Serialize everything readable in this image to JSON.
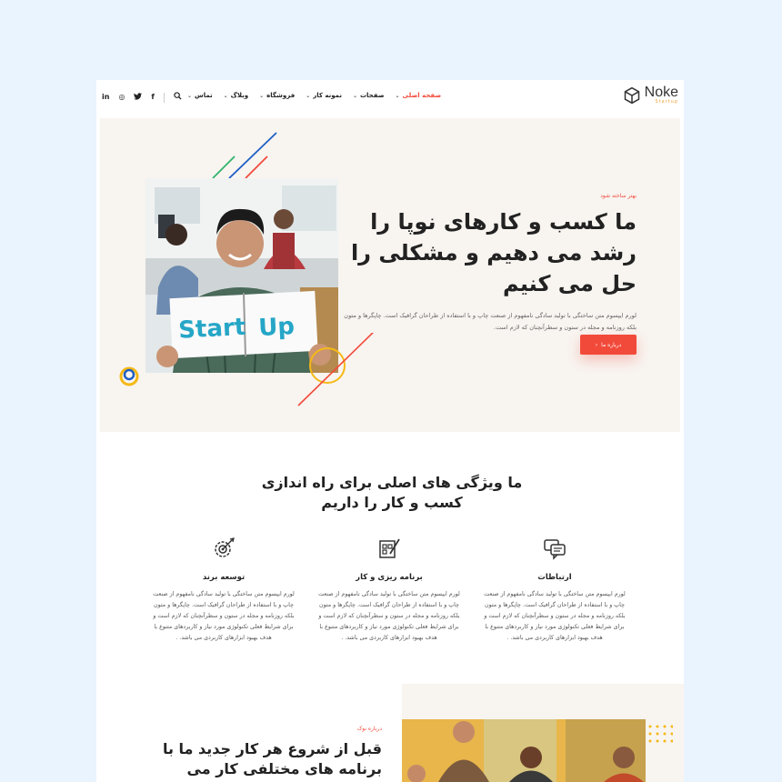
{
  "brand": {
    "name": "Noke",
    "tagline": "Startup"
  },
  "nav": {
    "items": [
      {
        "label": "صفحه اصلی",
        "active": true
      },
      {
        "label": "صفحات",
        "active": false
      },
      {
        "label": "نمونه کار",
        "active": false
      },
      {
        "label": "فروشگاه",
        "active": false
      },
      {
        "label": "وبلاگ",
        "active": false
      },
      {
        "label": "تماس",
        "active": false
      }
    ]
  },
  "social": {
    "icons": [
      "linkedin-icon",
      "instagram-icon",
      "twitter-icon",
      "facebook-icon",
      "search-icon"
    ],
    "glyphs": [
      "in",
      "◎",
      "🐦",
      "f",
      "⌕"
    ]
  },
  "hero": {
    "kicker": "بهتر ساخته شود",
    "title": "ما کسب و کارهای نوپا را رشد می دهیم و مشکلی را حل می کنیم",
    "description": "لورم ایپسوم متن ساختگی با تولید سادگی نامفهوم از صنعت چاپ و با استفاده از طراحان گرافیک است. چاپگرها و متون بلکه روزنامه و مجله در ستون و سطرآنچنان که لازم است.",
    "button_label": "درباره ما",
    "image_text": "Start Up"
  },
  "features": {
    "title": "ما ویژگی های اصلی برای راه اندازی کسب و کار را داریم",
    "items": [
      {
        "title": "ارتباطات",
        "icon": "chat-icon",
        "text": "لورم ایپسوم متن ساختگی با تولید سادگی نامفهوم از صنعت چاپ و با استفاده از طراحان گرافیک است. چاپگرها و متون بلکه روزنامه و مجله در ستون و سطرآنچنان که لازم است و برای شرایط فعلی تکنولوژی مورد نیاز و کاربردهای متنوع با هدف بهبود ابزارهای کاربردی می باشد. ."
      },
      {
        "title": "برنامه ریزی و کار",
        "icon": "planning-icon",
        "text": "لورم ایپسوم متن ساختگی با تولید سادگی نامفهوم از صنعت چاپ و با استفاده از طراحان گرافیک است. چاپگرها و متون بلکه روزنامه و مجله در ستون و سطرآنچنان که لازم است و برای شرایط فعلی تکنولوژی مورد نیاز و کاربردهای متنوع با هدف بهبود ابزارهای کاربردی می باشد. ."
      },
      {
        "title": "توسعه برند",
        "icon": "gear-target-icon",
        "text": "لورم ایپسوم متن ساختگی با تولید سادگی نامفهوم از صنعت چاپ و با استفاده از طراحان گرافیک است. چاپگرها و متون بلکه روزنامه و مجله در ستون و سطرآنچنان که لازم است و برای شرایط فعلی تکنولوژی مورد نیاز و کاربردهای متنوع با هدف بهبود ابزارهای کاربردی می باشد. ."
      }
    ]
  },
  "about": {
    "kicker": "درباره نوک",
    "title": "قبل از شروع هر کار جدید ما با برنامه های مختلفی کار می کنیم"
  },
  "colors": {
    "accent": "#f24a3a",
    "hero_bg": "#f8f4f0",
    "page_bg": "#eaf4fe",
    "yellow": "#f5b916",
    "blue": "#1f5fc4",
    "green": "#2fb26b"
  }
}
